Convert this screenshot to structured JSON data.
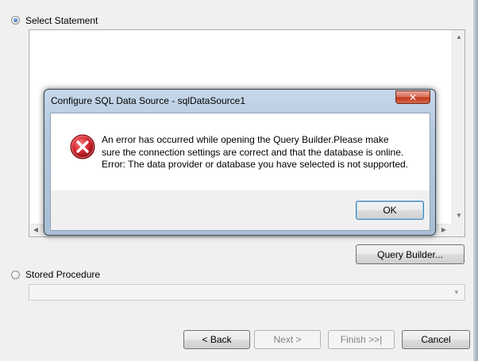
{
  "options": {
    "select_statement_label": "Select Statement",
    "stored_procedure_label": "Stored Procedure"
  },
  "buttons": {
    "query_builder": "Query Builder...",
    "back": "< Back",
    "next": "Next >",
    "finish": "Finish >>|",
    "cancel": "Cancel"
  },
  "dialog": {
    "title": "Configure SQL Data Source - sqlDataSource1",
    "close_glyph": "✕",
    "message_line1": "An error has occurred while opening the Query Builder.Please make",
    "message_line2": "sure the connection settings are correct and that the database is online.",
    "message_line3": "Error: The data provider or database you have selected is not supported.",
    "ok_label": "OK",
    "icon": "error-icon"
  },
  "colors": {
    "error_red": "#d6262f",
    "close_red": "#c2391d",
    "dialog_frame": "#b4c9df"
  }
}
